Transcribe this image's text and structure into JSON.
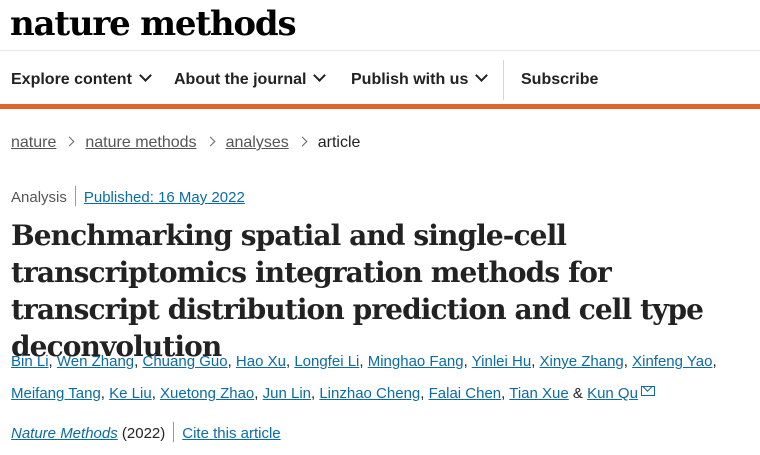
{
  "site": {
    "logo": "nature methods"
  },
  "nav": {
    "explore": "Explore content",
    "about": "About the journal",
    "publish": "Publish with us",
    "subscribe": "Subscribe"
  },
  "breadcrumb": [
    "nature",
    "nature methods",
    "analyses",
    "article"
  ],
  "article": {
    "type": "Analysis",
    "published": "Published: 16 May 2022",
    "title": "Benchmarking spatial and single-cell transcriptomics integration methods for transcript distribution prediction and cell type deconvolution",
    "authors": [
      "Bin Li",
      "Wen Zhang",
      "Chuang Guo",
      "Hao Xu",
      "Longfei Li",
      "Minghao Fang",
      "Yinlei Hu",
      "Xinye Zhang",
      "Xinfeng Yao",
      "Meifang Tang",
      "Ke Liu",
      "Xuetong Zhao",
      "Jun Lin",
      "Linzhao Cheng",
      "Falai Chen",
      "Tian Xue",
      "Kun Qu"
    ],
    "author_connector": "&",
    "journal": "Nature Methods",
    "year": "(2022)",
    "cite": "Cite this article"
  },
  "colors": {
    "accent": "#e0652b",
    "link": "#0b6ba4"
  }
}
